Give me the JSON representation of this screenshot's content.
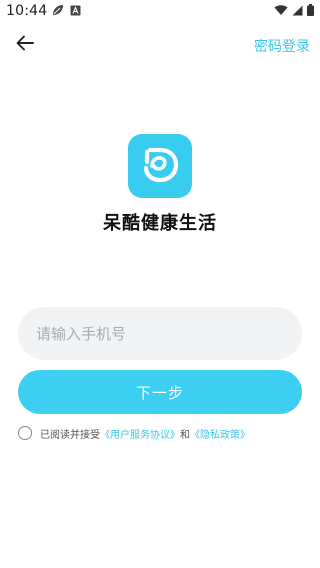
{
  "status_bar": {
    "time": "10:44",
    "icons": [
      "leaf-icon",
      "a-box-icon",
      "wifi-icon",
      "signal-icon",
      "battery-icon"
    ]
  },
  "header": {
    "back_icon": "arrow-left-icon",
    "password_login_label": "密码登录"
  },
  "app": {
    "name": "呆酷健康生活",
    "logo_icon": "app-logo-icon"
  },
  "form": {
    "phone_placeholder": "请输入手机号",
    "phone_value": "",
    "next_label": "下一步"
  },
  "agreement": {
    "prefix": "已阅读并接受",
    "user_agreement": "《用户服务协议》",
    "connector": "和",
    "privacy_policy": "《隐私政策》"
  },
  "colors": {
    "accent": "#3ccff1",
    "link": "#38c9e8",
    "input_bg": "#f2f3f5"
  }
}
